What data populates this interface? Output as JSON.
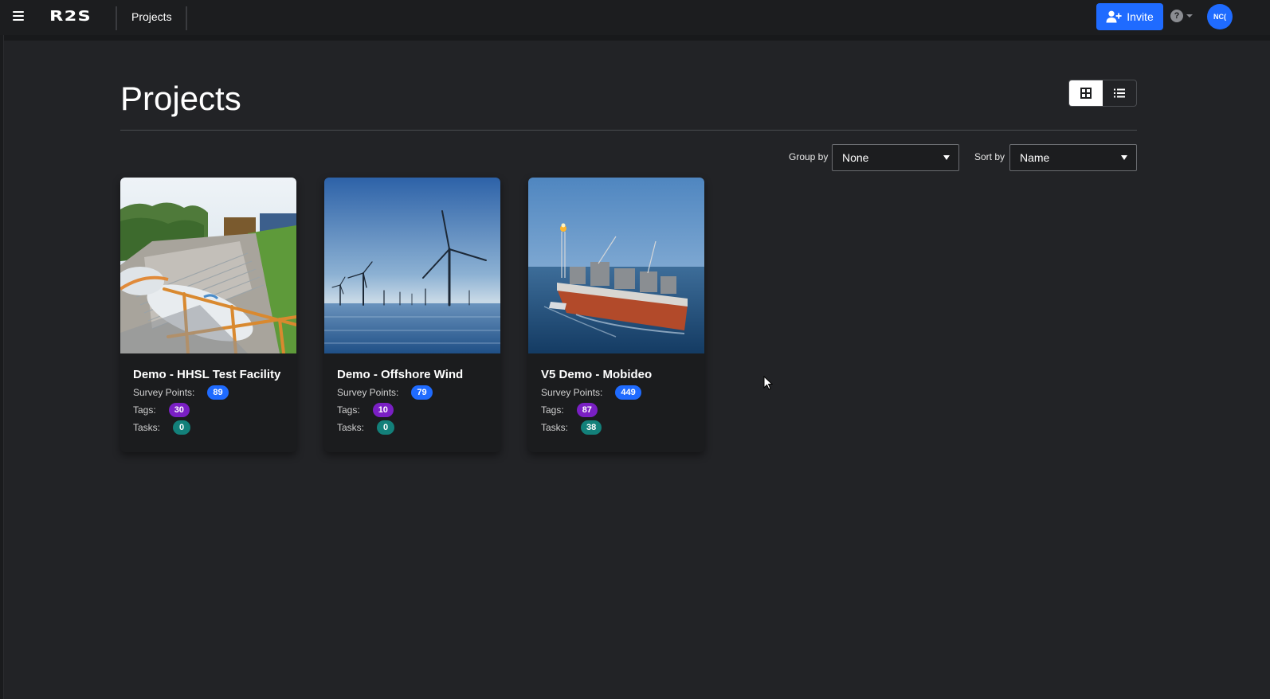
{
  "header": {
    "logo": "R2S",
    "breadcrumb": "Projects",
    "invite_label": "Invite",
    "help_symbol": "?",
    "avatar_initials": "NC("
  },
  "page": {
    "title": "Projects",
    "view_modes": [
      "grid",
      "list"
    ],
    "active_view": "grid"
  },
  "filters": {
    "group_by_label": "Group by",
    "group_by_value": "None",
    "sort_by_label": "Sort by",
    "sort_by_value": "Name"
  },
  "projects": [
    {
      "title": "Demo - HHSL Test Facility",
      "survey_points_label": "Survey Points:",
      "survey_points": "89",
      "tags_label": "Tags:",
      "tags": "30",
      "tasks_label": "Tasks:",
      "tasks": "0"
    },
    {
      "title": "Demo - Offshore Wind",
      "survey_points_label": "Survey Points:",
      "survey_points": "79",
      "tags_label": "Tags:",
      "tags": "10",
      "tasks_label": "Tasks:",
      "tasks": "0"
    },
    {
      "title": "V5 Demo - Mobideo",
      "survey_points_label": "Survey Points:",
      "survey_points": "449",
      "tags_label": "Tags:",
      "tags": "87",
      "tasks_label": "Tasks:",
      "tasks": "38"
    }
  ],
  "colors": {
    "background": "#222326",
    "topbar": "#1c1d1f",
    "accent_blue": "#1f6bff",
    "badge_purple": "#7a1fc4",
    "badge_teal": "#13807a"
  },
  "icons": {
    "menu": "hamburger-menu-icon",
    "invite": "user-plus-icon",
    "help": "help-circle-icon",
    "grid_view": "grid-view-icon",
    "list_view": "list-view-icon",
    "dropdown": "caret-down-icon"
  }
}
